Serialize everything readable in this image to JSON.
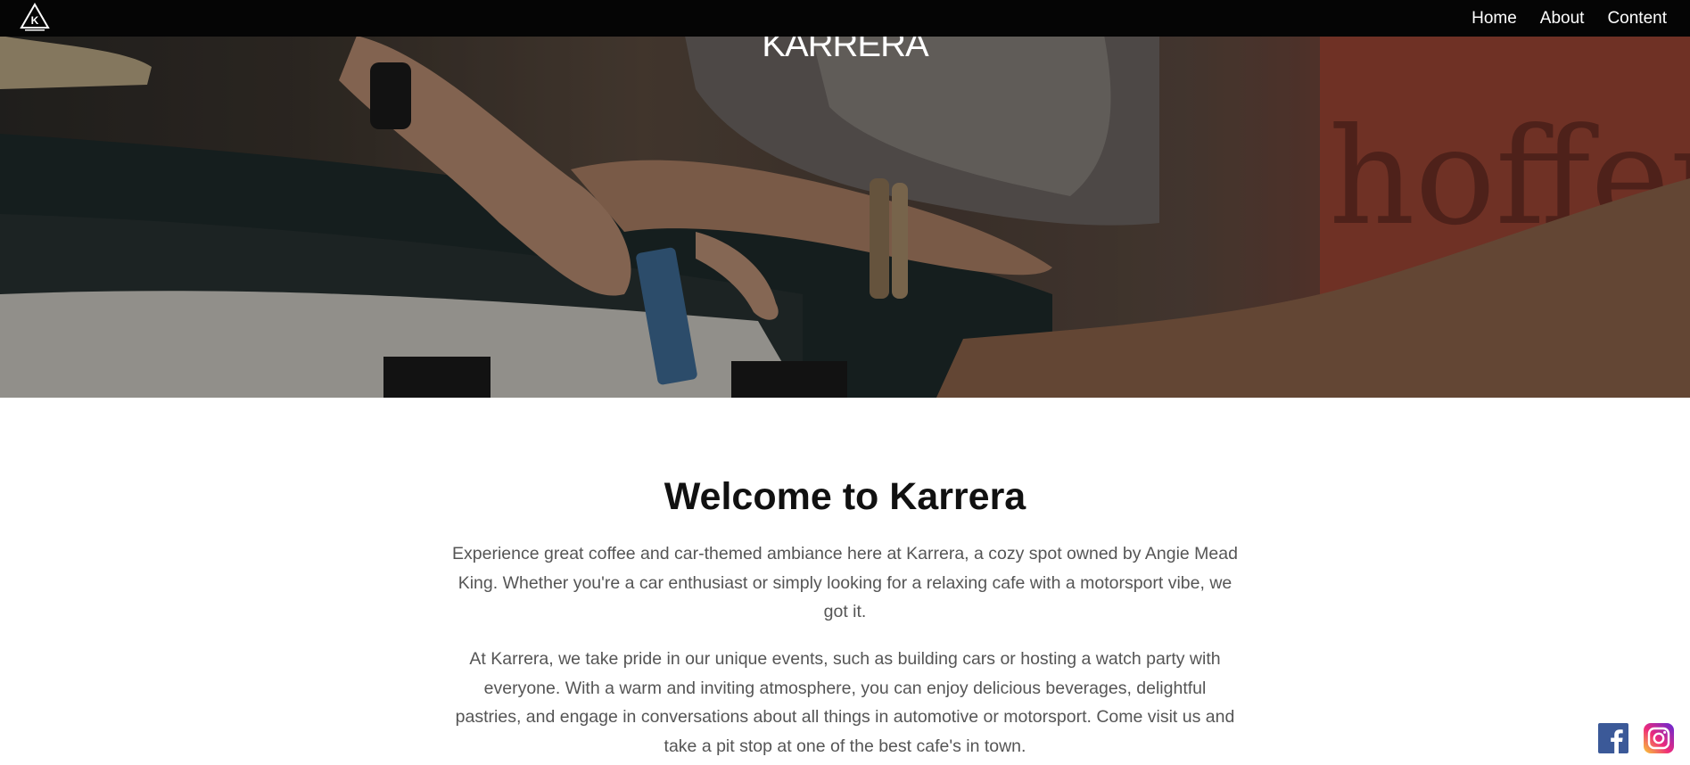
{
  "nav": {
    "logo_letter": "K",
    "links": [
      "Home",
      "About",
      "Content"
    ]
  },
  "hero": {
    "brand": "KARRERA",
    "background_sign_text": "hoffer"
  },
  "main": {
    "title": "Welcome to Karrera",
    "paragraphs": [
      "Experience great coffee and car-themed ambiance here at Karrera, a cozy spot owned by Angie Mead King. Whether you're a car enthusiast or simply looking for a relaxing cafe with a motorsport vibe, we got it.",
      "At Karrera, we take pride in our unique events, such as building cars or hosting a watch party with everyone. With a warm and inviting atmosphere, you can enjoy delicious beverages, delightful pastries, and engage in conversations about all things in automotive or motorsport. Come visit us and take a pit stop at one of the best cafe's in town."
    ]
  },
  "social": {
    "facebook_icon": "facebook-icon",
    "instagram_icon": "instagram-icon"
  },
  "colors": {
    "navbar": "#050505",
    "facebook": "#3b5998",
    "text": "#555555",
    "heading": "#111111"
  }
}
